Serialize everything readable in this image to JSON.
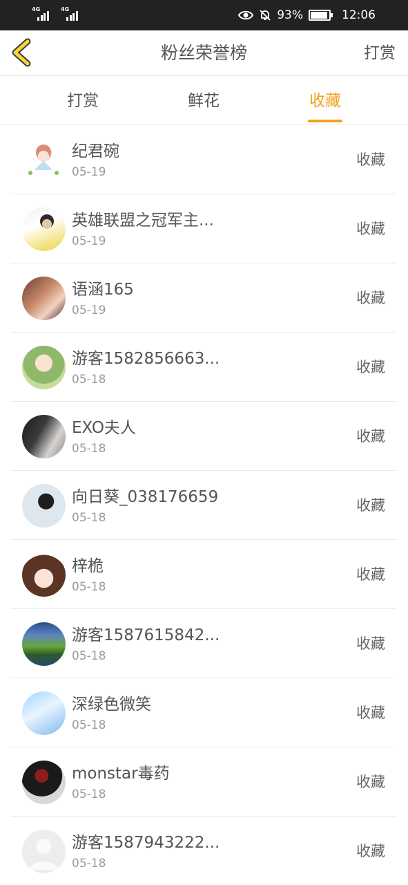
{
  "status_bar": {
    "signal1_tag": "4G",
    "signal2_tag": "4G",
    "battery_percent": "93%",
    "time": "12:06",
    "icons": [
      "eye-icon",
      "bell-off-icon",
      "battery-icon"
    ]
  },
  "nav": {
    "back_icon": "chevron-left-icon",
    "title": "粉丝荣誉榜",
    "action_label": "打赏"
  },
  "tabs": [
    {
      "label": "打赏",
      "active": false
    },
    {
      "label": "鲜花",
      "active": false
    },
    {
      "label": "收藏",
      "active": true
    }
  ],
  "fans": [
    {
      "name": "纪君碗",
      "date": "05-19",
      "action": "收藏"
    },
    {
      "name": "英雄联盟之冠军主...",
      "date": "05-19",
      "action": "收藏"
    },
    {
      "name": "语涵165",
      "date": "05-19",
      "action": "收藏"
    },
    {
      "name": "游客1582856663...",
      "date": "05-18",
      "action": "收藏"
    },
    {
      "name": "EXO夫人",
      "date": "05-18",
      "action": "收藏"
    },
    {
      "name": "向日葵_038176659",
      "date": "05-18",
      "action": "收藏"
    },
    {
      "name": "梓桅",
      "date": "05-18",
      "action": "收藏"
    },
    {
      "name": "游客1587615842...",
      "date": "05-18",
      "action": "收藏"
    },
    {
      "name": "深绿色微笑",
      "date": "05-18",
      "action": "收藏"
    },
    {
      "name": "monstar毒药",
      "date": "05-18",
      "action": "收藏"
    },
    {
      "name": "游客1587943222...",
      "date": "05-18",
      "action": "收藏"
    }
  ],
  "colors": {
    "accent": "#f0a21e",
    "status_bar": "#222222",
    "back_icon": "#f5d53a"
  }
}
